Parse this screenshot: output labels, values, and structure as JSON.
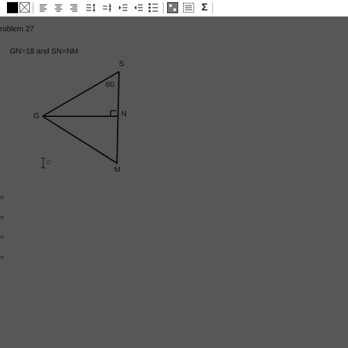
{
  "toolbar": {
    "buttons": [
      {
        "name": "fill-color-swatch-icon"
      },
      {
        "name": "no-fill-icon"
      },
      {
        "name": "align-left-icon"
      },
      {
        "name": "align-center-icon"
      },
      {
        "name": "align-right-icon"
      },
      {
        "name": "line-spacing-icon"
      },
      {
        "name": "paragraph-spacing-icon"
      },
      {
        "name": "increase-indent-icon"
      },
      {
        "name": "decrease-indent-icon"
      },
      {
        "name": "bullet-list-icon"
      },
      {
        "name": "insert-image-icon"
      },
      {
        "name": "insert-table-icon"
      },
      {
        "name": "sigma-icon"
      }
    ],
    "sigma_glyph": "Σ"
  },
  "page": {
    "title": "roblem 27",
    "given": "GN=18 and SN=NM"
  },
  "figure": {
    "labels": {
      "S": "S",
      "G": "G",
      "N": "N",
      "M": "M",
      "angle": "60"
    }
  },
  "equations": [
    "=",
    "=",
    "=",
    "="
  ],
  "colors": {
    "background": "#575757",
    "ink": "#0f0f0f",
    "toolbar": "#ffffff"
  }
}
